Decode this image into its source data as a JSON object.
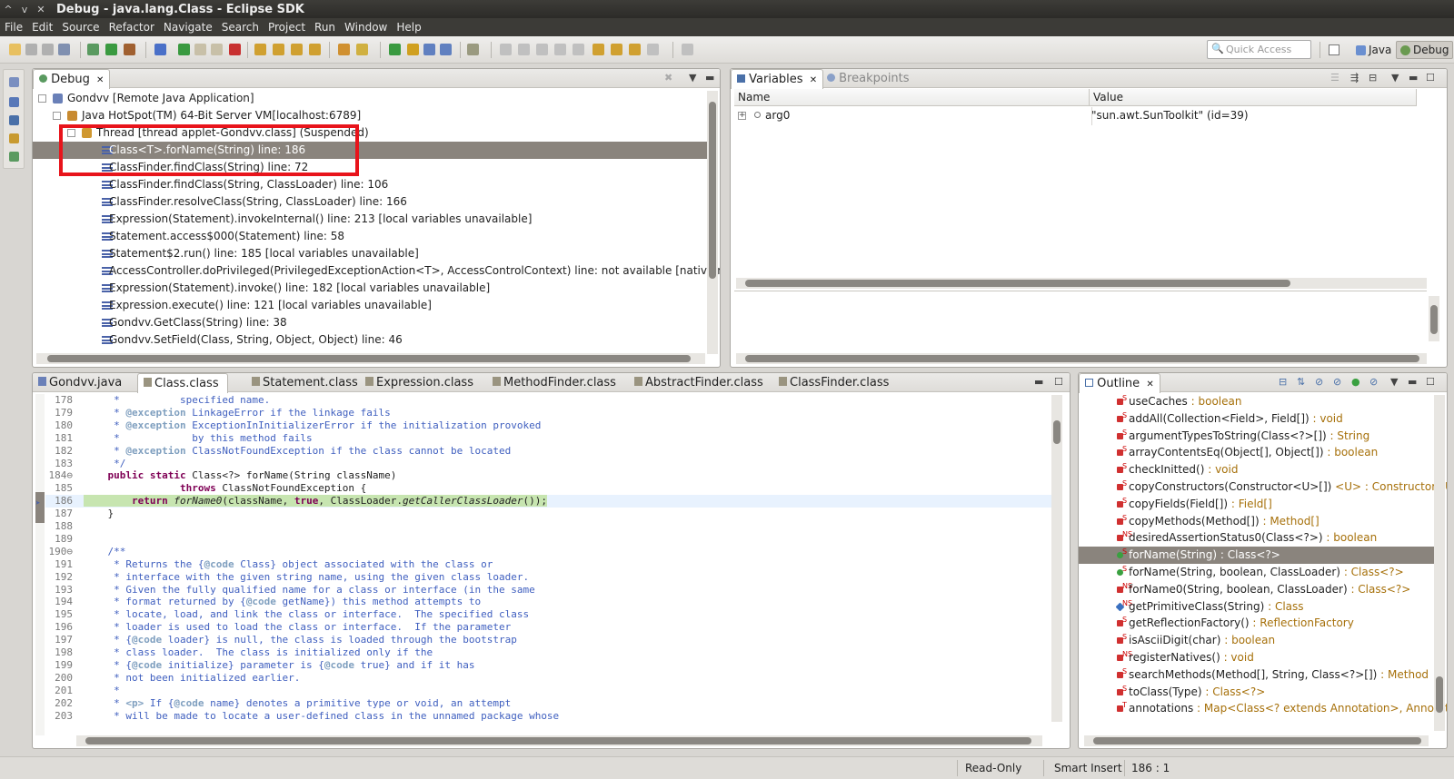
{
  "window": {
    "title": "Debug - java.lang.Class - Eclipse SDK"
  },
  "menu": [
    "File",
    "Edit",
    "Source",
    "Refactor",
    "Navigate",
    "Search",
    "Project",
    "Run",
    "Window",
    "Help"
  ],
  "toolbar": {
    "quick_access_placeholder": "Quick Access",
    "perspectives": [
      {
        "label": "Java",
        "active": false
      },
      {
        "label": "Debug",
        "active": true
      }
    ]
  },
  "debug_view": {
    "tab": "Debug",
    "tree": [
      {
        "label": "Gondvv [Remote Java Application]",
        "icon": "launch-icon",
        "indent": 0,
        "twisty": "-"
      },
      {
        "label": "Java HotSpot(TM) 64-Bit Server VM[localhost:6789]",
        "icon": "vm-icon",
        "indent": 1,
        "twisty": "-"
      },
      {
        "label": "Thread [thread applet-Gondvv.class] (Suspended)",
        "icon": "thread-suspended-icon",
        "indent": 2,
        "twisty": "-"
      },
      {
        "label": "Class<T>.forName(String) line: 186",
        "icon": "stack-frame-icon",
        "indent": 3,
        "selected": true
      },
      {
        "label": "ClassFinder.findClass(String) line: 72",
        "icon": "stack-frame-icon",
        "indent": 3
      },
      {
        "label": "ClassFinder.findClass(String, ClassLoader) line: 106",
        "icon": "stack-frame-icon",
        "indent": 3
      },
      {
        "label": "ClassFinder.resolveClass(String, ClassLoader) line: 166",
        "icon": "stack-frame-icon",
        "indent": 3
      },
      {
        "label": "Expression(Statement).invokeInternal() line: 213 [local variables unavailable]",
        "icon": "stack-frame-icon",
        "indent": 3
      },
      {
        "label": "Statement.access$000(Statement) line: 58",
        "icon": "stack-frame-icon",
        "indent": 3
      },
      {
        "label": "Statement$2.run() line: 185 [local variables unavailable]",
        "icon": "stack-frame-icon",
        "indent": 3
      },
      {
        "label": "AccessController.doPrivileged(PrivilegedExceptionAction<T>, AccessControlContext) line: not available [native method]",
        "icon": "stack-frame-icon",
        "indent": 3
      },
      {
        "label": "Expression(Statement).invoke() line: 182 [local variables unavailable]",
        "icon": "stack-frame-icon",
        "indent": 3
      },
      {
        "label": "Expression.execute() line: 121 [local variables unavailable]",
        "icon": "stack-frame-icon",
        "indent": 3
      },
      {
        "label": "Gondvv.GetClass(String) line: 38",
        "icon": "stack-frame-icon",
        "indent": 3
      },
      {
        "label": "Gondvv.SetField(Class, String, Object, Object) line: 46",
        "icon": "stack-frame-icon",
        "indent": 3
      }
    ]
  },
  "variables_view": {
    "tabs": [
      {
        "label": "Variables",
        "active": true
      },
      {
        "label": "Breakpoints",
        "active": false
      }
    ],
    "columns": [
      "Name",
      "Value"
    ],
    "rows": [
      {
        "name": "arg0",
        "value": "\"sun.awt.SunToolkit\" (id=39)"
      }
    ]
  },
  "editor": {
    "tabs": [
      {
        "label": "Gondvv.java",
        "active": false
      },
      {
        "label": "Class.class",
        "active": true
      },
      {
        "label": "Statement.class",
        "active": false
      },
      {
        "label": "Expression.class",
        "active": false
      },
      {
        "label": "MethodFinder.class",
        "active": false
      },
      {
        "label": "AbstractFinder.class",
        "active": false
      },
      {
        "label": "ClassFinder.class",
        "active": false
      }
    ],
    "lines": [
      {
        "n": "178",
        "t": "     *          specified name."
      },
      {
        "n": "179",
        "t": "     * @exception LinkageError if the linkage fails"
      },
      {
        "n": "180",
        "t": "     * @exception ExceptionInInitializerError if the initialization provoked"
      },
      {
        "n": "181",
        "t": "     *            by this method fails"
      },
      {
        "n": "182",
        "t": "     * @exception ClassNotFoundException if the class cannot be located"
      },
      {
        "n": "183",
        "t": "     */"
      },
      {
        "n": "184⊖",
        "t": "    public static Class<?> forName(String className)"
      },
      {
        "n": "185",
        "t": "                throws ClassNotFoundException {"
      },
      {
        "n": "186",
        "t": "        return forName0(className, true, ClassLoader.getCallerClassLoader());"
      },
      {
        "n": "187",
        "t": "    }"
      },
      {
        "n": "188",
        "t": ""
      },
      {
        "n": "189",
        "t": ""
      },
      {
        "n": "190⊖",
        "t": "    /**"
      },
      {
        "n": "191",
        "t": "     * Returns the {@code Class} object associated with the class or"
      },
      {
        "n": "192",
        "t": "     * interface with the given string name, using the given class loader."
      },
      {
        "n": "193",
        "t": "     * Given the fully qualified name for a class or interface (in the same"
      },
      {
        "n": "194",
        "t": "     * format returned by {@code getName}) this method attempts to"
      },
      {
        "n": "195",
        "t": "     * locate, load, and link the class or interface.  The specified class"
      },
      {
        "n": "196",
        "t": "     * loader is used to load the class or interface.  If the parameter"
      },
      {
        "n": "197",
        "t": "     * {@code loader} is null, the class is loaded through the bootstrap"
      },
      {
        "n": "198",
        "t": "     * class loader.  The class is initialized only if the"
      },
      {
        "n": "199",
        "t": "     * {@code initialize} parameter is {@code true} and if it has"
      },
      {
        "n": "200",
        "t": "     * not been initialized earlier."
      },
      {
        "n": "201",
        "t": "     *"
      },
      {
        "n": "202",
        "t": "     * <p> If {@code name} denotes a primitive type or void, an attempt"
      },
      {
        "n": "203",
        "t": "     * will be made to locate a user-defined class in the unnamed package whose"
      }
    ],
    "current_line": "186"
  },
  "outline_view": {
    "tab": "Outline",
    "items": [
      {
        "name": "useCaches",
        "type": " : boolean",
        "vis": "private",
        "mod": "S"
      },
      {
        "name": "addAll(Collection<Field>, Field[])",
        "type": " : void",
        "vis": "private",
        "mod": "S"
      },
      {
        "name": "argumentTypesToString(Class<?>[])",
        "type": " : String",
        "vis": "private",
        "mod": "S"
      },
      {
        "name": "arrayContentsEq(Object[], Object[])",
        "type": " : boolean",
        "vis": "private",
        "mod": "S"
      },
      {
        "name": "checkInitted()",
        "type": " : void",
        "vis": "private",
        "mod": "S"
      },
      {
        "name": "copyConstructors(Constructor<U>[])",
        "type": " <U> : Constructor<U>[]",
        "vis": "private",
        "mod": "S"
      },
      {
        "name": "copyFields(Field[])",
        "type": " : Field[]",
        "vis": "private",
        "mod": "S"
      },
      {
        "name": "copyMethods(Method[])",
        "type": " : Method[]",
        "vis": "private",
        "mod": "S"
      },
      {
        "name": "desiredAssertionStatus0(Class<?>)",
        "type": " : boolean",
        "vis": "private",
        "mod": "NS"
      },
      {
        "name": "forName(String)",
        "type": " : Class<?>",
        "vis": "public",
        "mod": "S",
        "selected": true
      },
      {
        "name": "forName(String, boolean, ClassLoader)",
        "type": " : Class<?>",
        "vis": "public",
        "mod": "S"
      },
      {
        "name": "forName0(String, boolean, ClassLoader)",
        "type": " : Class<?>",
        "vis": "private",
        "mod": "NS"
      },
      {
        "name": "getPrimitiveClass(String)",
        "type": " : Class",
        "vis": "default",
        "mod": "NS"
      },
      {
        "name": "getReflectionFactory()",
        "type": " : ReflectionFactory",
        "vis": "private",
        "mod": "S"
      },
      {
        "name": "isAsciiDigit(char)",
        "type": " : boolean",
        "vis": "private",
        "mod": "S"
      },
      {
        "name": "registerNatives()",
        "type": " : void",
        "vis": "private",
        "mod": "NS"
      },
      {
        "name": "searchMethods(Method[], String, Class<?>[])",
        "type": " : Method",
        "vis": "private",
        "mod": "S"
      },
      {
        "name": "toClass(Type)",
        "type": " : Class<?>",
        "vis": "private",
        "mod": "S"
      },
      {
        "name": "annotations",
        "type": " : Map<Class<? extends Annotation>, Annotation>",
        "vis": "private",
        "mod": "T"
      }
    ]
  },
  "status_bar": {
    "mode": "Read-Only",
    "insert": "Smart Insert",
    "position": "186 : 1"
  },
  "colors": {
    "selection": "#8a847d",
    "highlight_box": "#e8141b",
    "comment": "#3f5fbf",
    "keyword": "#7f0055"
  }
}
